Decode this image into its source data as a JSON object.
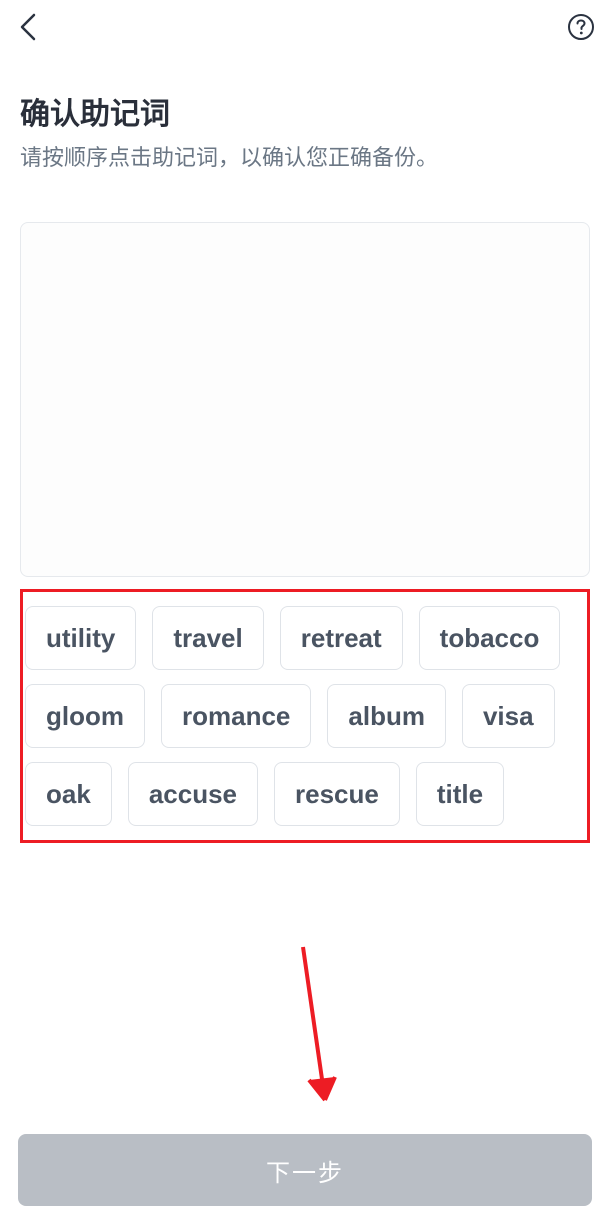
{
  "header": {
    "back_icon": "chevron-left",
    "help_icon": "question-circle"
  },
  "page": {
    "title": "确认助记词",
    "subtitle": "请按顺序点击助记词，以确认您正确备份。"
  },
  "words": [
    "utility",
    "travel",
    "retreat",
    "tobacco",
    "gloom",
    "romance",
    "album",
    "visa",
    "oak",
    "accuse",
    "rescue",
    "title"
  ],
  "footer": {
    "next_label": "下一步"
  },
  "annotations": {
    "highlight_color": "#ed1c24",
    "arrow_color": "#ed1c24"
  }
}
